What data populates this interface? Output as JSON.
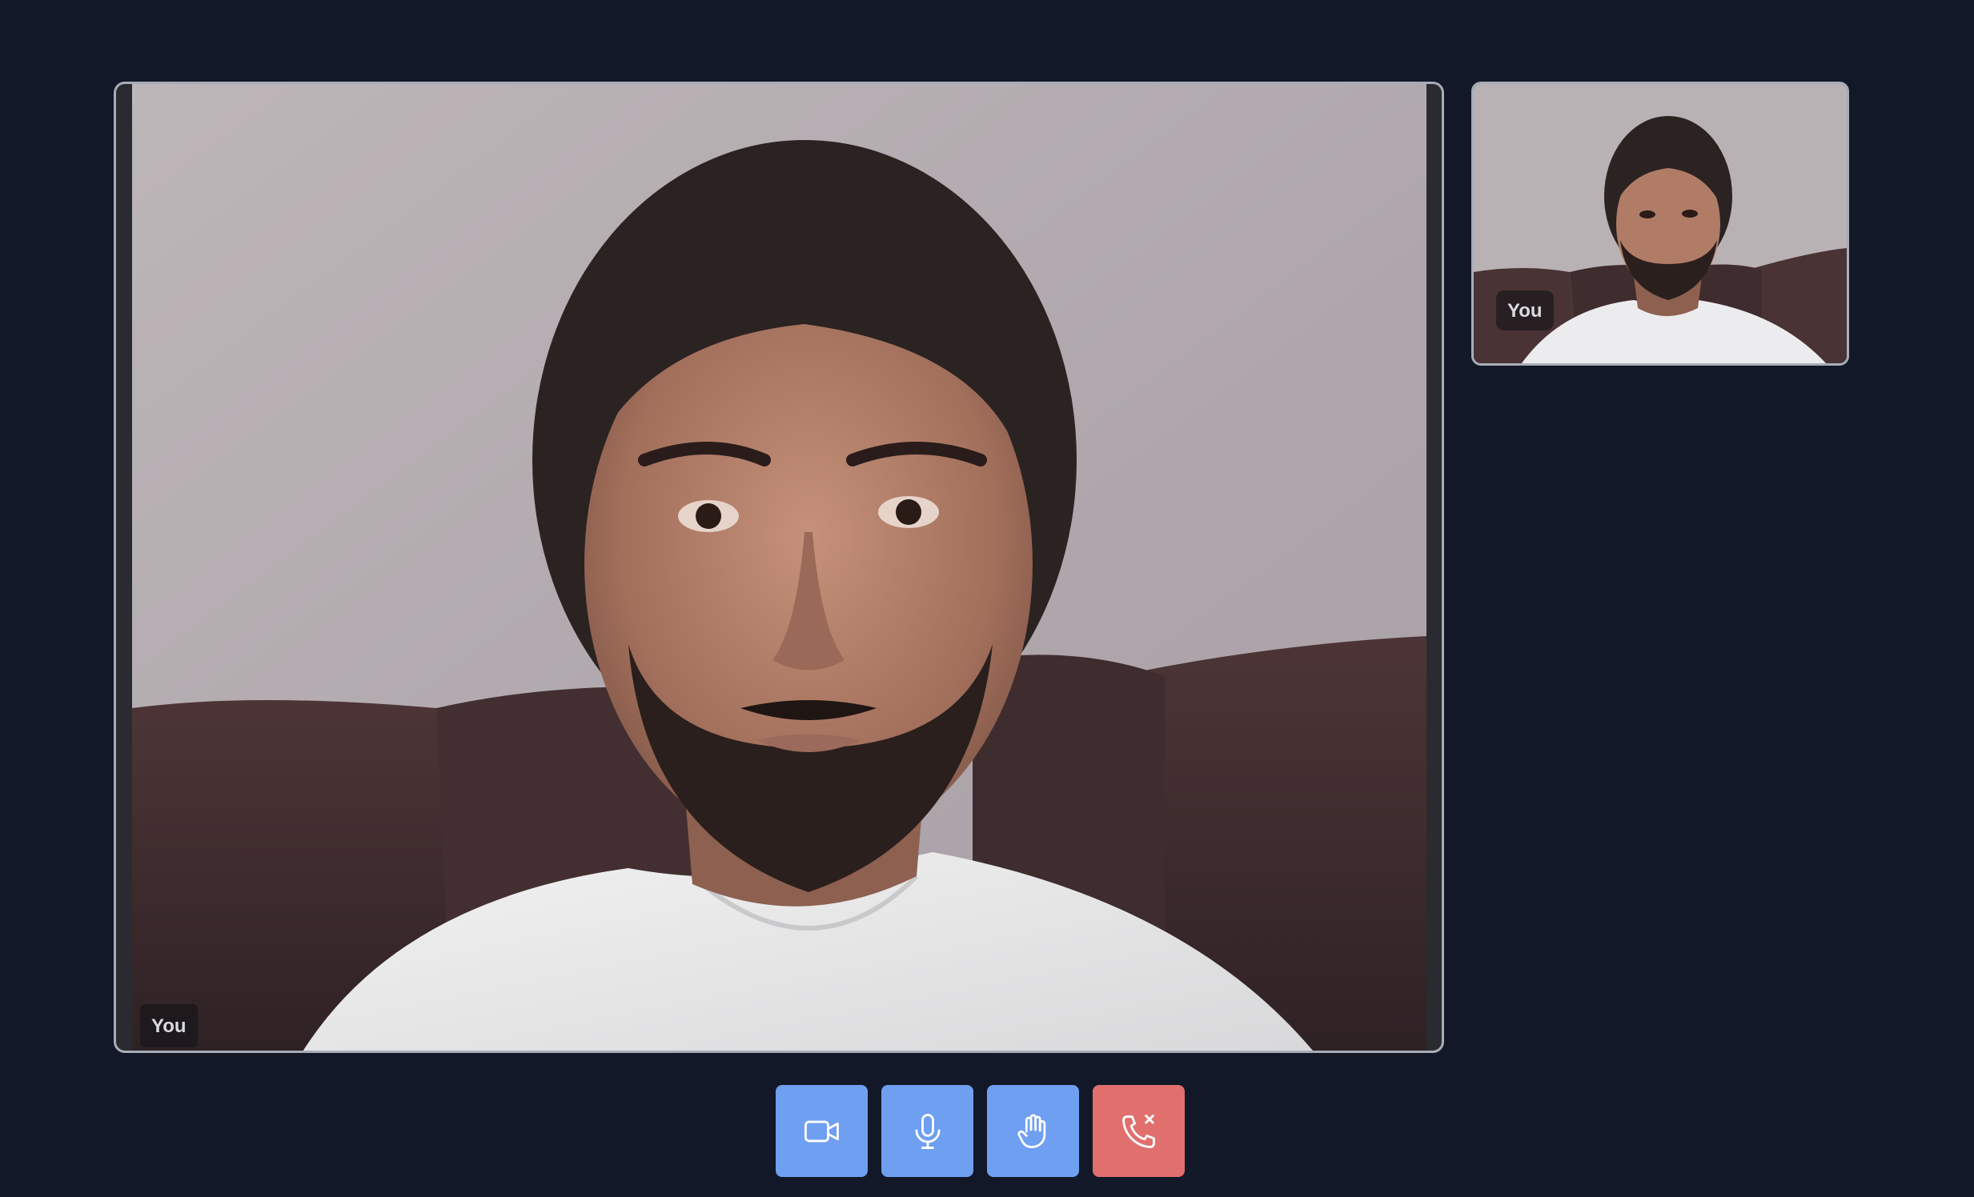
{
  "participants": {
    "main": {
      "label": "You"
    },
    "thumbnail": {
      "label": "You"
    }
  },
  "controls": [
    {
      "name": "camera-button",
      "icon": "video-camera-icon",
      "color": "#6f9ff1"
    },
    {
      "name": "microphone-button",
      "icon": "microphone-icon",
      "color": "#6f9ff1"
    },
    {
      "name": "raise-hand-button",
      "icon": "hand-icon",
      "color": "#6f9ff1"
    },
    {
      "name": "end-call-button",
      "icon": "phone-hangup-icon",
      "color": "#e06f6e"
    }
  ],
  "theme": {
    "background": "#121827",
    "tile_border": "#a7adb8",
    "label_text": "#d9dbe0"
  }
}
